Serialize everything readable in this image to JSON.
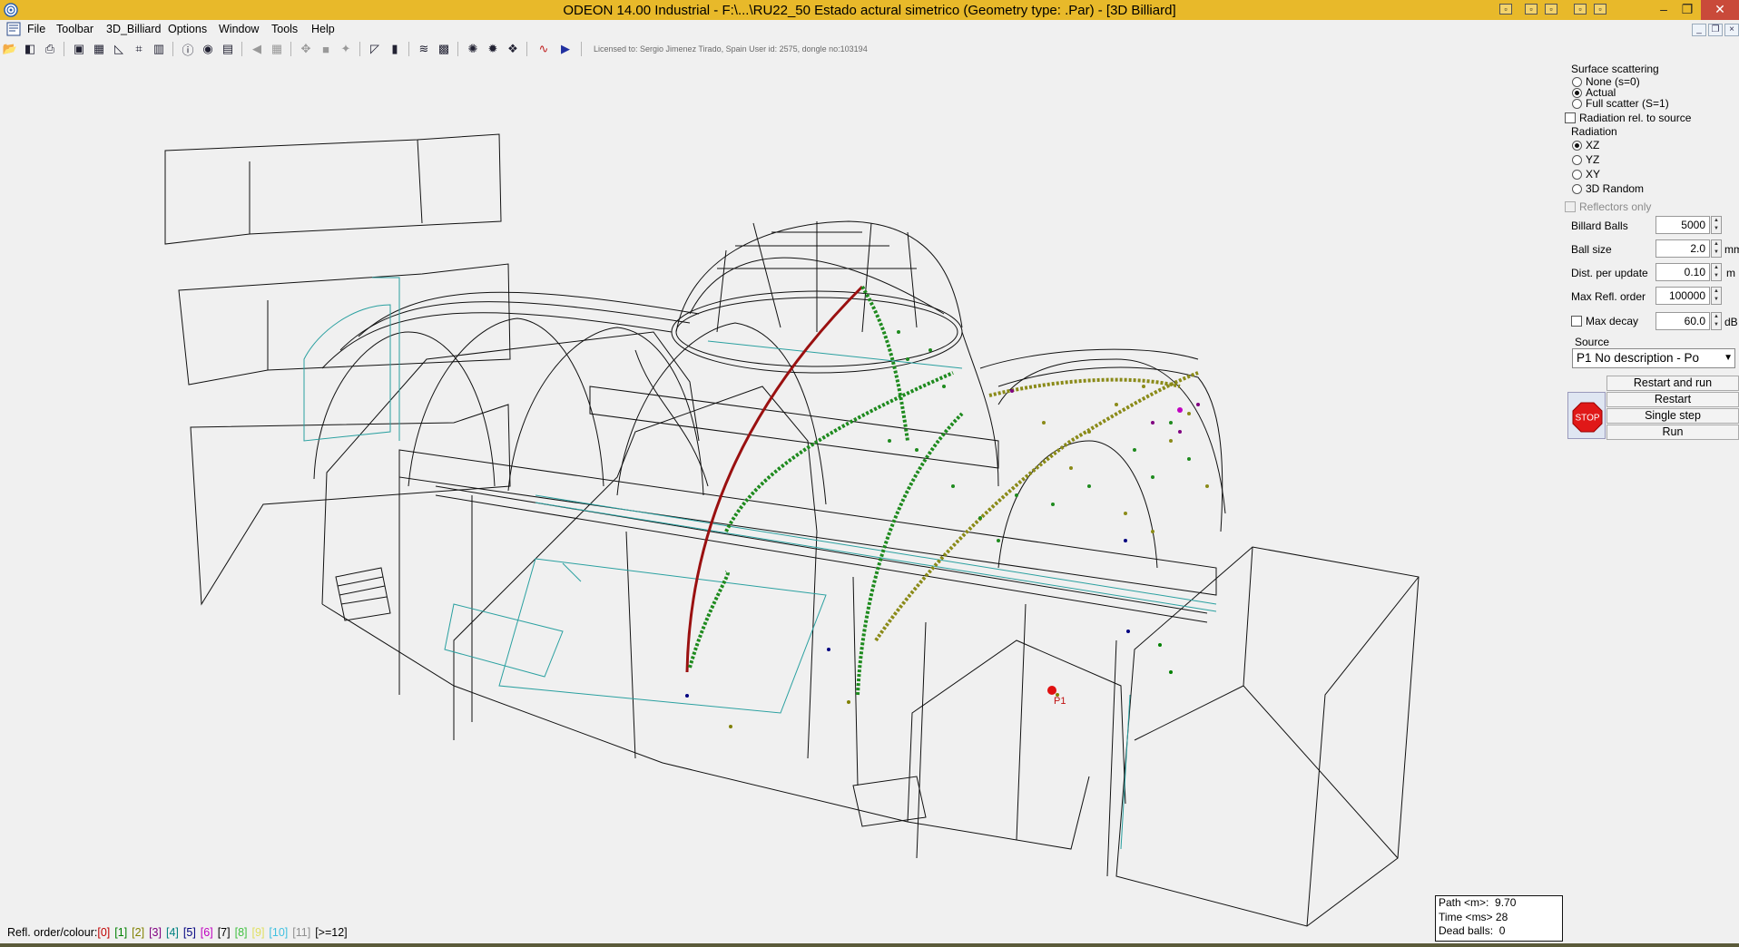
{
  "window": {
    "title": "ODEON 14.00 Industrial  -  F:\\...\\RU22_50 Estado actural simetrico      (Geometry type: .Par) - [3D Billiard]",
    "minimize_glyph": "–",
    "restore_glyph": "❐",
    "close_glyph": "✕"
  },
  "menu": [
    "File",
    "Toolbar",
    "3D_Billiard",
    "Options",
    "Window",
    "Tools",
    "Help"
  ],
  "license": "Licensed to: Sergio Jimenez Tirado, Spain    User id: 2575, dongle no:103194",
  "panel": {
    "surface_scattering_label": "Surface scattering",
    "scatter_options": [
      "None (s=0)",
      "Actual",
      "Full scatter (S=1)"
    ],
    "scatter_selected": "Actual",
    "radiation_rel_label": "Radiation rel. to source",
    "radiation_label": "Radiation",
    "radiation_options": [
      "XZ",
      "YZ",
      "XY",
      "3D Random"
    ],
    "radiation_selected": "XZ",
    "reflectors_only_label": "Reflectors only",
    "billiard_balls_label": "Billard Balls",
    "billiard_balls_value": "5000",
    "ball_size_label": "Ball size",
    "ball_size_value": "2.0",
    "ball_size_unit": "mm",
    "dist_label": "Dist. per update",
    "dist_value": "0.10",
    "dist_unit": "m",
    "max_refl_label": "Max Refl. order",
    "max_refl_value": "100000",
    "max_decay_label": "Max decay",
    "max_decay_value": "60.0",
    "max_decay_unit": "dB",
    "source_label": "Source",
    "source_value": "P1 No description  -  Po",
    "restart_and_run": "Restart and run",
    "restart": "Restart",
    "single_step": "Single step",
    "run": "Run",
    "stop": "STOP"
  },
  "status": {
    "path_label": "Path <m>:",
    "path_value": "9.70",
    "time_label": "Time <ms>",
    "time_value": "28",
    "dead_label": "Dead balls:",
    "dead_value": "0"
  },
  "legend": {
    "label": "Refl. order/colour:",
    "items": [
      {
        "text": "[0]",
        "color": "#c00000"
      },
      {
        "text": "[1]",
        "color": "#008000"
      },
      {
        "text": "[2]",
        "color": "#808000"
      },
      {
        "text": "[3]",
        "color": "#800080"
      },
      {
        "text": "[4]",
        "color": "#008080"
      },
      {
        "text": "[5]",
        "color": "#000080"
      },
      {
        "text": "[6]",
        "color": "#c000c0"
      },
      {
        "text": "[7]",
        "color": "#000000"
      },
      {
        "text": "[8]",
        "color": "#40c040"
      },
      {
        "text": "[9]",
        "color": "#e0e060"
      },
      {
        "text": "[10]",
        "color": "#40c0e0"
      },
      {
        "text": "[11]",
        "color": "#909090"
      },
      {
        "text": "[>=12]",
        "color": "#000000"
      }
    ]
  },
  "source_marker": "P1"
}
